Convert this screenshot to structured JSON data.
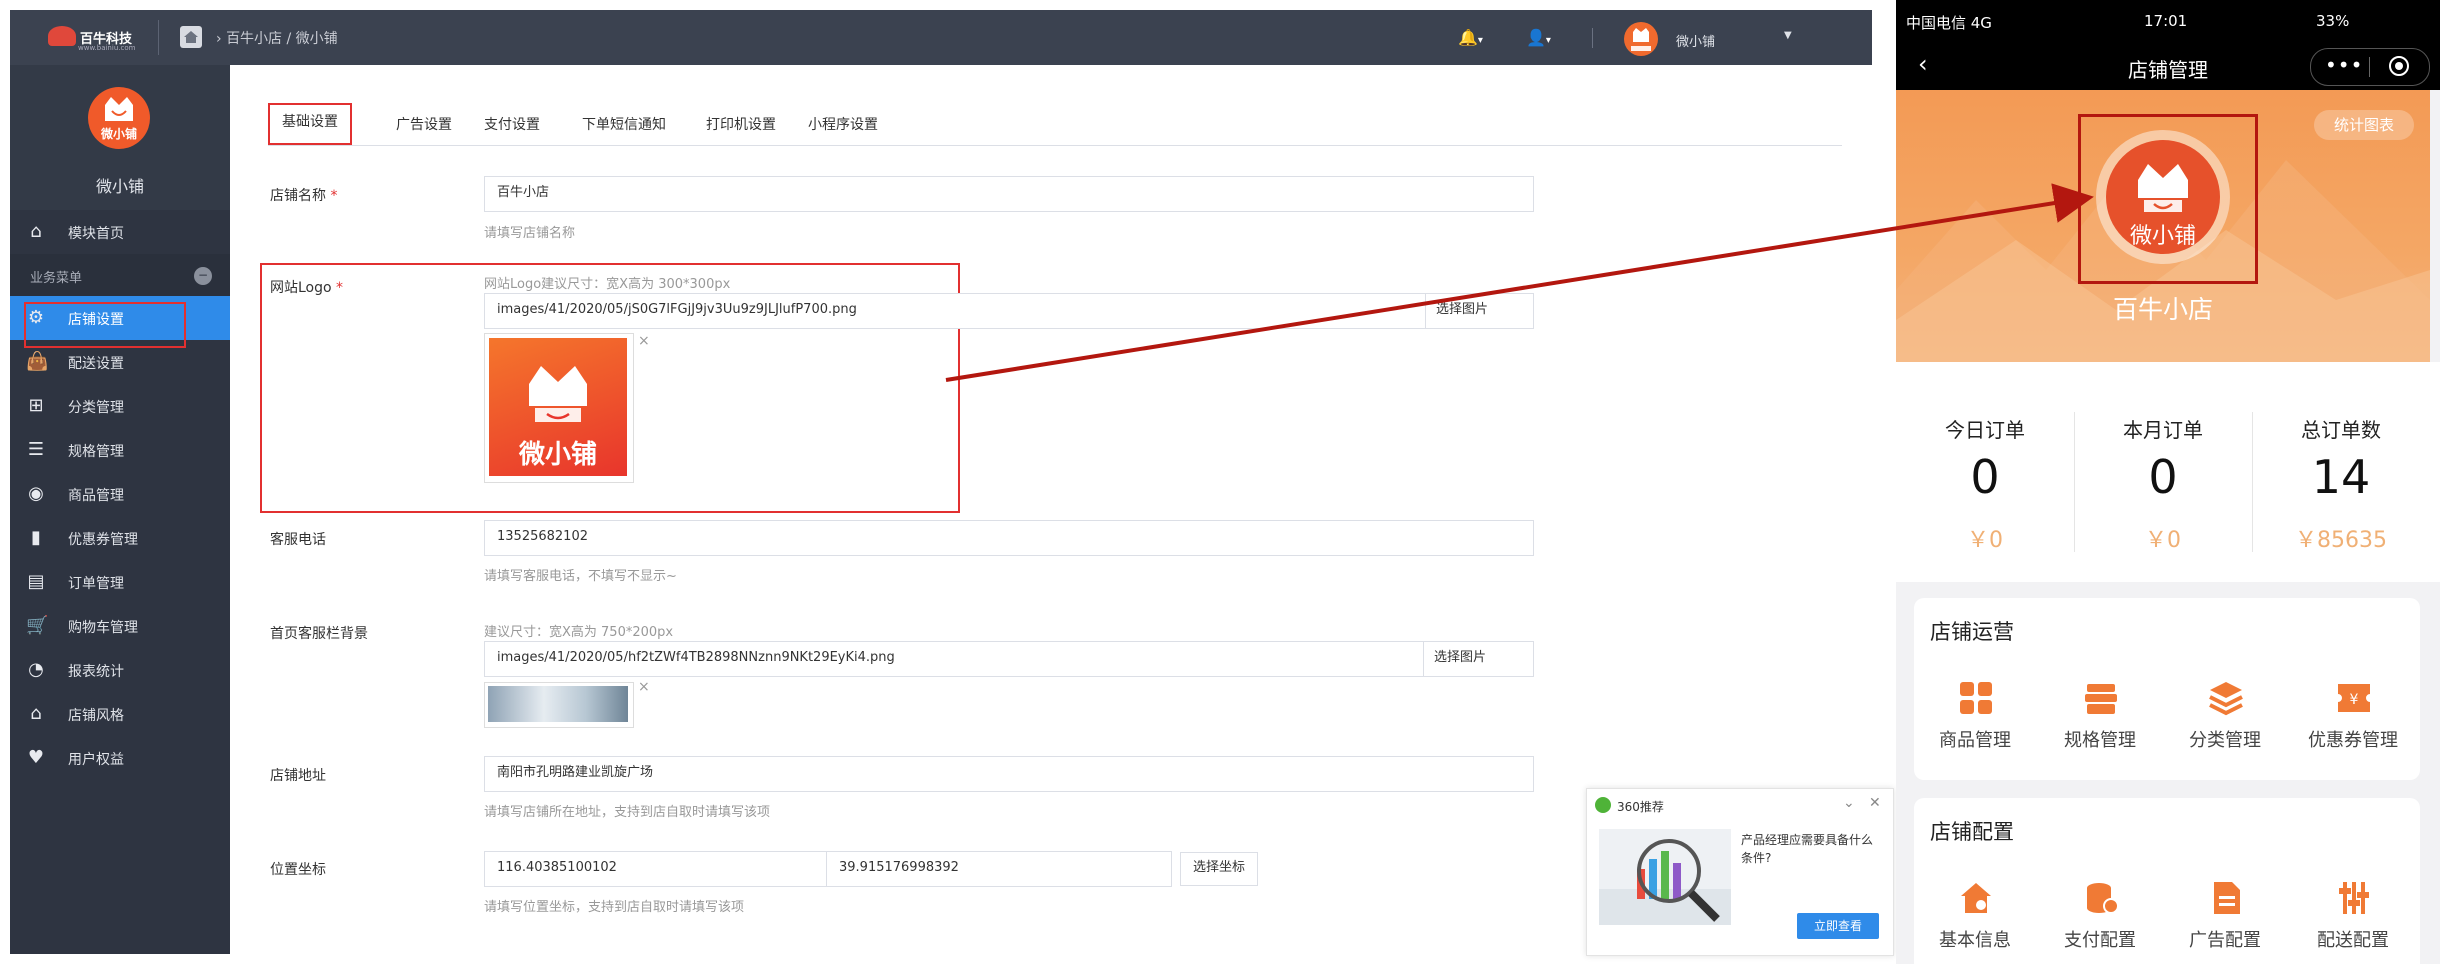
{
  "admin": {
    "brand": {
      "name": "百牛科技",
      "sub": "www.bainiu.com"
    },
    "breadcrumb": "百牛小店 / 微小铺",
    "user_name": "微小铺",
    "sidebar": {
      "shop_name": "微小铺",
      "logo_text": "微小铺",
      "home_item": "模块首页",
      "section_label": "业务菜单",
      "items": [
        {
          "label": "店铺设置",
          "icon": "gear-icon"
        },
        {
          "label": "配送设置",
          "icon": "bag-icon"
        },
        {
          "label": "分类管理",
          "icon": "grid-icon"
        },
        {
          "label": "规格管理",
          "icon": "list-icon"
        },
        {
          "label": "商品管理",
          "icon": "goods-icon"
        },
        {
          "label": "优惠券管理",
          "icon": "coupon-icon"
        },
        {
          "label": "订单管理",
          "icon": "order-icon"
        },
        {
          "label": "购物车管理",
          "icon": "cart-icon"
        },
        {
          "label": "报表统计",
          "icon": "pie-icon"
        },
        {
          "label": "店铺风格",
          "icon": "house-icon"
        },
        {
          "label": "用户权益",
          "icon": "heart-icon"
        }
      ],
      "active_index": 0
    },
    "tabs": [
      "基础设置",
      "广告设置",
      "支付设置",
      "下单短信通知",
      "打印机设置",
      "小程序设置"
    ],
    "form": {
      "shop_name_label": "店铺名称",
      "shop_name_value": "百牛小店",
      "shop_name_help": "请填写店铺名称",
      "logo_label": "网站Logo",
      "logo_hint": "网站Logo建议尺寸：宽X高为 300*300px",
      "logo_path": "images/41/2020/05/jS0G7lFGjJ9jv3Uu9z9JLJlufP700.png",
      "logo_btn": "选择图片",
      "logo_img_text": "微小铺",
      "phone_label": "客服电话",
      "phone_value": "13525682102",
      "phone_help": "请填写客服电话，不填写不显示~",
      "bg_label": "首页客服栏背景",
      "bg_hint": "建议尺寸：宽X高为 750*200px",
      "bg_path": "images/41/2020/05/hf2tZWf4TB2898NNznn9NKt29EyKi4.png",
      "bg_btn": "选择图片",
      "addr_label": "店铺地址",
      "addr_value": "南阳市孔明路建业凯旋广场",
      "addr_help": "请填写店铺所在地址，支持到店自取时请填写该项",
      "coord_label": "位置坐标",
      "coord_lng": "116.40385100102",
      "coord_lat": "39.915176998392",
      "coord_btn": "选择坐标",
      "coord_help": "请填写位置坐标，支持到店自取时请填写该项",
      "required_mark": "*"
    },
    "ad": {
      "title": "360推荐",
      "text": "产品经理应需要具备什么条件?",
      "button": "立即查看"
    }
  },
  "phone": {
    "status": {
      "signal": "中国电信  4G",
      "time": "17:01",
      "battery": "33%"
    },
    "nav_title": "店铺管理",
    "stat_button": "统计图表",
    "logo_text": "微小铺",
    "shop_name": "百牛小店",
    "stats": [
      {
        "label": "今日订单",
        "value": "0",
        "money": "￥0"
      },
      {
        "label": "本月订单",
        "value": "0",
        "money": "￥0"
      },
      {
        "label": "总订单数",
        "value": "14",
        "money": "￥85635"
      }
    ],
    "ops_title": "店铺运营",
    "ops_items": [
      "商品管理",
      "规格管理",
      "分类管理",
      "优惠券管理"
    ],
    "config_title": "店铺配置",
    "config_items": [
      "基本信息",
      "支付配置",
      "广告配置",
      "配送配置"
    ],
    "accent": "#f07a35"
  }
}
